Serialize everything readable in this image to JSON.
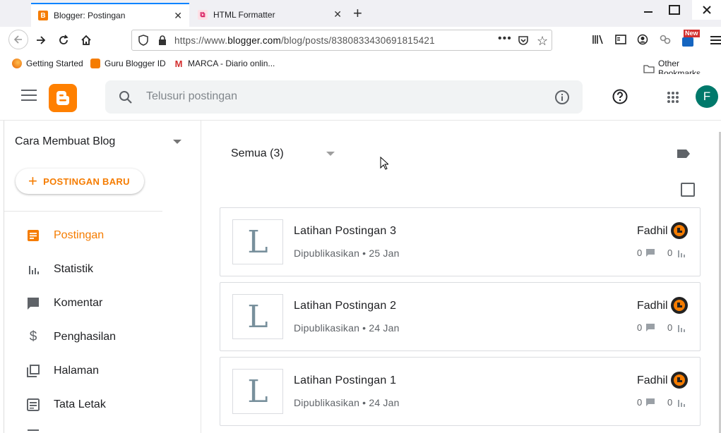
{
  "browser": {
    "tabs": [
      {
        "label": "Blogger: Postingan",
        "favicon": "blogger-favicon",
        "active": true
      },
      {
        "label": "HTML Formatter",
        "favicon": "html-formatter-favicon",
        "active": false
      }
    ],
    "url_prefix": "https://www.",
    "url_domain": "blogger.com",
    "url_path": "/blog/posts/8380833430691815421",
    "bookmarks": [
      {
        "label": "Getting Started",
        "icon": "firefox-icon"
      },
      {
        "label": "Guru Blogger ID",
        "icon": "blogger-bookmark-icon"
      },
      {
        "label": "MARCA - Diario onlin...",
        "icon": "marca-icon"
      },
      {
        "label": "Other Bookmarks",
        "icon": "folder-icon"
      }
    ],
    "new_badge": "New"
  },
  "header": {
    "search_placeholder": "Telusuri postingan",
    "avatar_letter": "F",
    "brand_color": "#ff8000"
  },
  "sidebar": {
    "blog_name": "Cara Membuat Blog",
    "new_post_label": "POSTINGAN BARU",
    "items": [
      {
        "label": "Postingan",
        "icon": "posts-icon",
        "active": true
      },
      {
        "label": "Statistik",
        "icon": "stats-icon",
        "active": false
      },
      {
        "label": "Komentar",
        "icon": "comment-icon",
        "active": false
      },
      {
        "label": "Penghasilan",
        "icon": "dollar-icon",
        "active": false
      },
      {
        "label": "Halaman",
        "icon": "pages-icon",
        "active": false
      },
      {
        "label": "Tata Letak",
        "icon": "layout-icon",
        "active": false
      }
    ]
  },
  "main": {
    "filter_label": "Semua (3)",
    "posts": [
      {
        "thumb": "L",
        "title": "Latihan Postingan 3",
        "status": "Dipublikasikan",
        "date": "25 Jan",
        "author": "Fadhil",
        "comments": "0",
        "views": "0"
      },
      {
        "thumb": "L",
        "title": "Latihan Postingan 2",
        "status": "Dipublikasikan",
        "date": "24 Jan",
        "author": "Fadhil",
        "comments": "0",
        "views": "0"
      },
      {
        "thumb": "L",
        "title": "Latihan Postingan 1",
        "status": "Dipublikasikan",
        "date": "24 Jan",
        "author": "Fadhil",
        "comments": "0",
        "views": "0"
      }
    ]
  }
}
